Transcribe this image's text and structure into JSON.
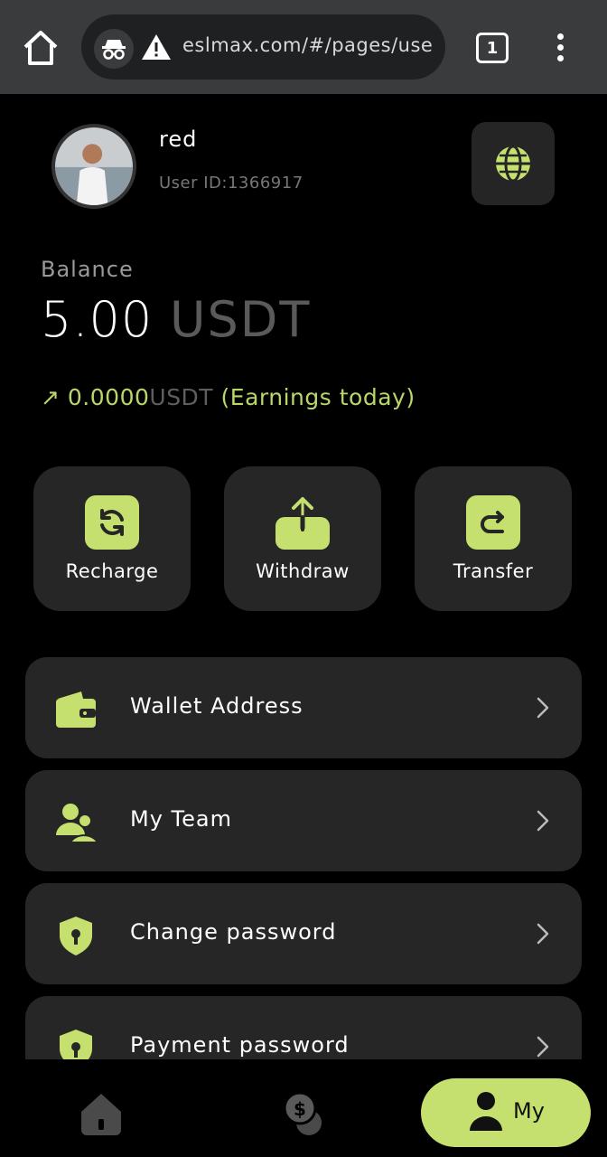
{
  "browser": {
    "url": "eslmax.com/#/pages/use",
    "tab_count": "1"
  },
  "profile": {
    "username": "red",
    "user_id": "User ID:1366917"
  },
  "balance": {
    "label": "Balance",
    "amount": "5.00",
    "unit": "USDT",
    "earnings_arrow": "↗",
    "earnings_value": "0.0000",
    "earnings_unit": "USDT",
    "earnings_label": "(Earnings today)"
  },
  "actions": [
    {
      "label": "Recharge",
      "icon": "refresh-icon"
    },
    {
      "label": "Withdraw",
      "icon": "upload-icon"
    },
    {
      "label": "Transfer",
      "icon": "transfer-icon"
    }
  ],
  "menu": [
    {
      "label": "Wallet Address",
      "icon": "wallet-icon"
    },
    {
      "label": "My Team",
      "icon": "team-icon"
    },
    {
      "label": "Change password",
      "icon": "shield-lock-icon"
    },
    {
      "label": "Payment password",
      "icon": "shield-lock-icon"
    }
  ],
  "nav": {
    "home_icon": "home-icon",
    "money_icon": "coins-icon",
    "my_label": "My"
  },
  "colors": {
    "accent": "#c5e06f",
    "card": "#262626",
    "background": "#000000"
  }
}
